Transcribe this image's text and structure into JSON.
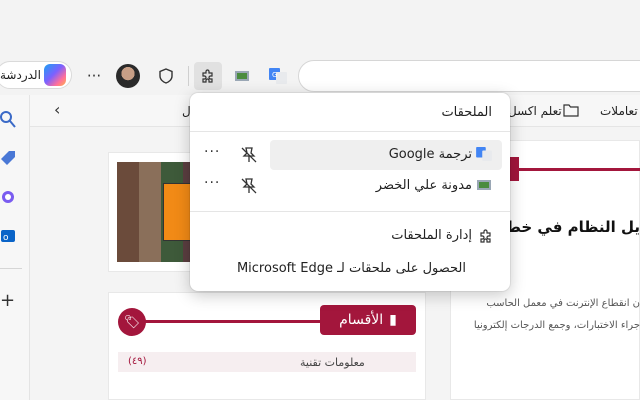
{
  "toolbar": {
    "copilot_label": "الدردشة",
    "more_label": "···"
  },
  "favorites": {
    "items": [
      "تعلم اكسل",
      "تعاملات"
    ],
    "partial_left": "ل"
  },
  "extensions_menu": {
    "title": "الملحقات",
    "extensions": [
      {
        "name": "ترجمة Google",
        "icon": "google-translate-icon",
        "highlighted": true
      },
      {
        "name": "مدونة علي الخضر",
        "icon": "blog-icon",
        "highlighted": false
      }
    ],
    "more_label": "···",
    "manage_label": "إدارة الملحقات",
    "get_label": "الحصول على ملحقات لـ Microsoft Edge"
  },
  "page": {
    "sections_label": "الأقسام",
    "article_title": "يل النظام في خطوة",
    "article_line1": "ن انقطاع الإنترنت في معمل الحاسب",
    "article_line2": "جراء الاختبارات، وجمع الدرجات إلكترونيا",
    "row_text": "معلومات تقنية",
    "row_count": "(٤٩)"
  },
  "colors": {
    "accent": "#a3163c",
    "popup_bg": "#ffffff",
    "highlight": "#efefef"
  }
}
